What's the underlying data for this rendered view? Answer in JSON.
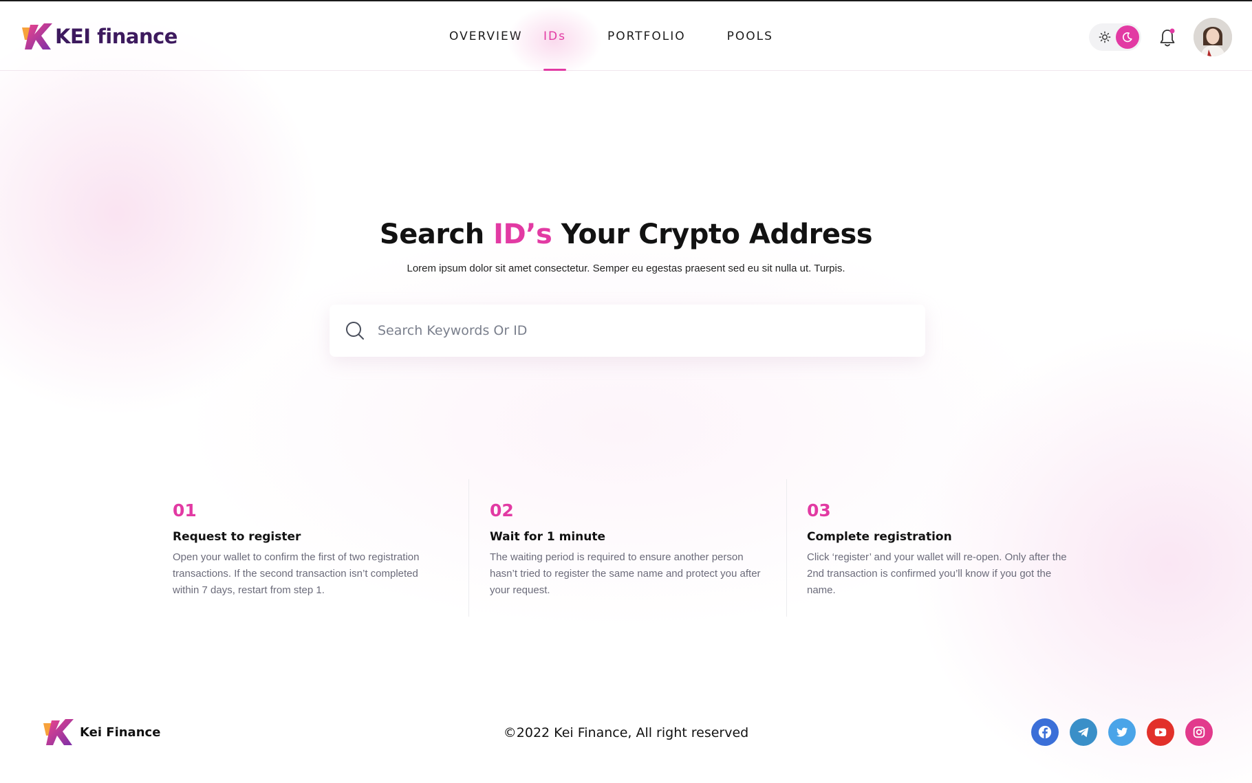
{
  "brand": {
    "name": "KEI finance",
    "footer_name": "Kei Finance"
  },
  "nav": {
    "items": [
      {
        "label": "OVERVIEW",
        "active": false
      },
      {
        "label": "IDs",
        "active": true
      },
      {
        "label": "PORTFOLIO",
        "active": false
      },
      {
        "label": "POOLS",
        "active": false
      }
    ]
  },
  "header_icons": [
    "sun-icon",
    "moon-icon",
    "bell-icon",
    "avatar"
  ],
  "theme": {
    "mode": "dark-toggle-selected"
  },
  "hero": {
    "title_before": "Search ",
    "title_accent": "ID’s",
    "title_after": " Your Crypto Address",
    "subtitle": "Lorem ipsum dolor sit amet consectetur. Semper eu egestas praesent sed eu sit nulla ut. Turpis."
  },
  "search": {
    "placeholder": "Search Keywords Or ID",
    "value": ""
  },
  "steps": [
    {
      "number": "01",
      "title": "Request to register",
      "description": "Open your wallet to confirm the first of two registration transactions. If the second transaction isn’t completed within 7 days, restart from step 1."
    },
    {
      "number": "02",
      "title": "Wait for 1 minute",
      "description": "The waiting period is required to ensure another person hasn’t tried to register the same name and protect you after your request."
    },
    {
      "number": "03",
      "title": "Complete registration",
      "description": "Click ‘register’ and your wallet will re-open. Only after the 2nd transaction is confirmed you’ll know if you got the name."
    }
  ],
  "footer": {
    "copyright": "©2022 Kei Finance, All right reserved",
    "socials": [
      {
        "name": "facebook-icon",
        "color": "#3b6fd8"
      },
      {
        "name": "telegram-icon",
        "color": "#3a8fc8"
      },
      {
        "name": "twitter-icon",
        "color": "#4aa4e8"
      },
      {
        "name": "youtube-icon",
        "color": "#e2302a"
      },
      {
        "name": "instagram-icon",
        "color": "#e23a8c"
      }
    ]
  },
  "colors": {
    "accent": "#e23aa3",
    "brand_dark": "#3d1a5e"
  }
}
